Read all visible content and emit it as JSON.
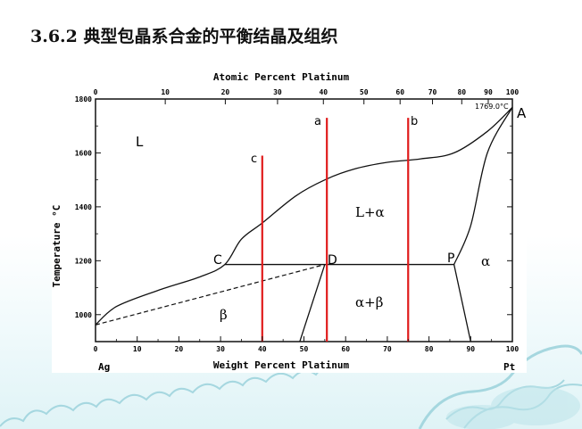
{
  "slide": {
    "title": "3.6.2 典型包晶系合金的平衡结晶及组织"
  },
  "chart_data": {
    "type": "phase-diagram",
    "title": "",
    "top_axis": {
      "label": "Atomic Percent Platinum",
      "ticks": [
        "0",
        "10",
        "20",
        "30",
        "40",
        "50",
        "60",
        "70",
        "80",
        "90",
        "100"
      ]
    },
    "x_axis": {
      "label": "Weight Percent Platinum",
      "ticks": [
        "0",
        "10",
        "20",
        "30",
        "40",
        "50",
        "60",
        "70",
        "80",
        "90",
        "100"
      ],
      "left_end_label": "Ag",
      "right_end_label": "Pt",
      "range": [
        0,
        100
      ]
    },
    "y_axis": {
      "label": "Temperature °C",
      "ticks": [
        "1000",
        "1200",
        "1400",
        "1600",
        "1800"
      ],
      "range": [
        900,
        1800
      ]
    },
    "melting_point_label": "1769.0°C",
    "point_labels": {
      "A": "A",
      "C": "C",
      "D": "D",
      "P": "P"
    },
    "phase_labels": {
      "liquid": "L",
      "liquid_alpha": "L+α",
      "alpha": "α",
      "alpha_beta": "α+β",
      "beta": "β"
    },
    "peritectic": {
      "temperature_c": 1186,
      "C_wt_pct": 31,
      "D_wt_pct": 55,
      "P_wt_pct": 86
    },
    "alloy_lines": [
      {
        "label": "a",
        "wt_pct": 55.5,
        "top_c": 1730
      },
      {
        "label": "b",
        "wt_pct": 75,
        "top_c": 1730
      },
      {
        "label": "c",
        "wt_pct": 40,
        "top_c": 1590
      }
    ],
    "curves": {
      "liquidus": [
        [
          0,
          962
        ],
        [
          5,
          1030
        ],
        [
          15,
          1090
        ],
        [
          25,
          1140
        ],
        [
          31,
          1186
        ],
        [
          35,
          1280
        ],
        [
          40,
          1340
        ],
        [
          48,
          1440
        ],
        [
          55,
          1500
        ],
        [
          62,
          1540
        ],
        [
          70,
          1565
        ],
        [
          78,
          1578
        ],
        [
          86,
          1600
        ],
        [
          94,
          1680
        ],
        [
          100,
          1769
        ]
      ],
      "solidus_alpha": [
        [
          86,
          1186
        ],
        [
          90,
          1330
        ],
        [
          94,
          1600
        ],
        [
          100,
          1769
        ]
      ],
      "solvus_alpha": [
        [
          86,
          1186
        ],
        [
          90,
          900
        ]
      ],
      "solvus_beta": [
        [
          55,
          1186
        ],
        [
          49,
          900
        ]
      ],
      "beta_dashed": [
        [
          0,
          962
        ],
        [
          55,
          1186
        ]
      ]
    },
    "colors": {
      "alloy_line": "#e01b1b",
      "curve": "#111111"
    }
  }
}
